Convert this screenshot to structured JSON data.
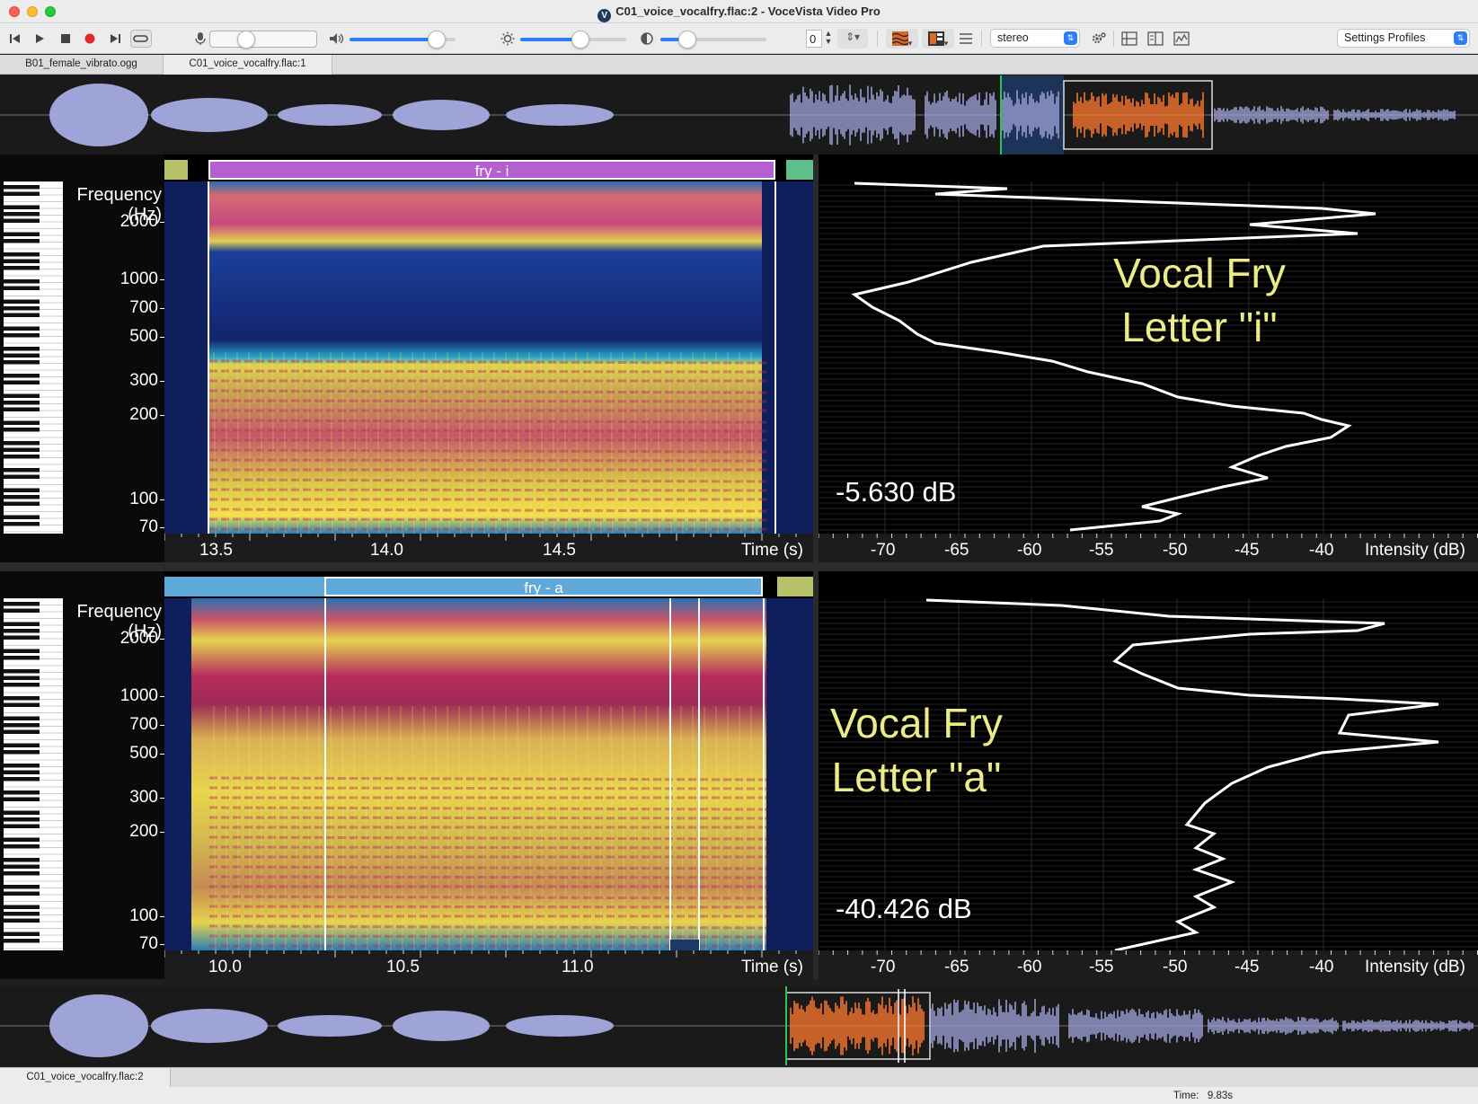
{
  "window": {
    "title": "C01_voice_vocalfry.flac:2 - VoceVista Video Pro"
  },
  "toolbar": {
    "loop_value": "0",
    "channel_select": "stereo",
    "settings_profiles": "Settings Profiles",
    "mic_level": 0.3,
    "volume_level": 0.82,
    "brightness_level": 0.57,
    "contrast_level": 0.25
  },
  "tabs": [
    {
      "label": "B01_female_vibrato.ogg",
      "active": false
    },
    {
      "label": "C01_voice_vocalfry.flac:1",
      "active": true
    }
  ],
  "bottom_tabs": [
    {
      "label": "C01_voice_vocalfry.flac:2",
      "active": true
    }
  ],
  "status": {
    "time_label": "Time:",
    "time_value": "9.83s"
  },
  "colors": {
    "segment_purple": "#b65fd1",
    "segment_blue": "#5ea9d9",
    "segment_green": "#5fbf8a",
    "segment_olive": "#b8c26a",
    "overview_wave": "#9ea3d8",
    "overview_highlight": "#ff7a2e",
    "caption_yellow": "#ebeb8a"
  },
  "panels": [
    {
      "segments": [
        {
          "label": "",
          "color": "#b8c26a"
        },
        {
          "label": "fry - i",
          "color": "#b65fd1"
        },
        {
          "label": "",
          "color": "#5fbf8a"
        }
      ],
      "freq_title": [
        "Frequency",
        "(Hz)"
      ],
      "freq_ticks": [
        "2000",
        "1000",
        "700",
        "500",
        "300",
        "200",
        "100",
        "70"
      ],
      "time_ticks": [
        "13.5",
        "14.0",
        "14.5"
      ],
      "time_label": "Time (s)",
      "db_ticks": [
        "-70",
        "-65",
        "-60",
        "-55",
        "-50",
        "-45",
        "-40"
      ],
      "intensity_label": "Intensity (dB)",
      "readout": "-5.630 dB",
      "caption": [
        "Vocal Fry",
        "Letter \"i\""
      ]
    },
    {
      "segments": [
        {
          "label": "",
          "color": "#5ea9d9"
        },
        {
          "label": "fry - a",
          "color": "#5ea9d9"
        },
        {
          "label": "",
          "color": "#b8c26a"
        }
      ],
      "freq_title": [
        "Frequency",
        "(Hz)"
      ],
      "freq_ticks": [
        "2000",
        "1000",
        "700",
        "500",
        "300",
        "200",
        "100",
        "70"
      ],
      "time_ticks": [
        "10.0",
        "10.5",
        "11.0"
      ],
      "time_label": "Time (s)",
      "db_ticks": [
        "-70",
        "-65",
        "-60",
        "-55",
        "-50",
        "-45",
        "-40"
      ],
      "intensity_label": "Intensity (dB)",
      "readout": "-40.426 dB",
      "caption": [
        "Vocal Fry",
        "Letter \"a\""
      ]
    }
  ]
}
